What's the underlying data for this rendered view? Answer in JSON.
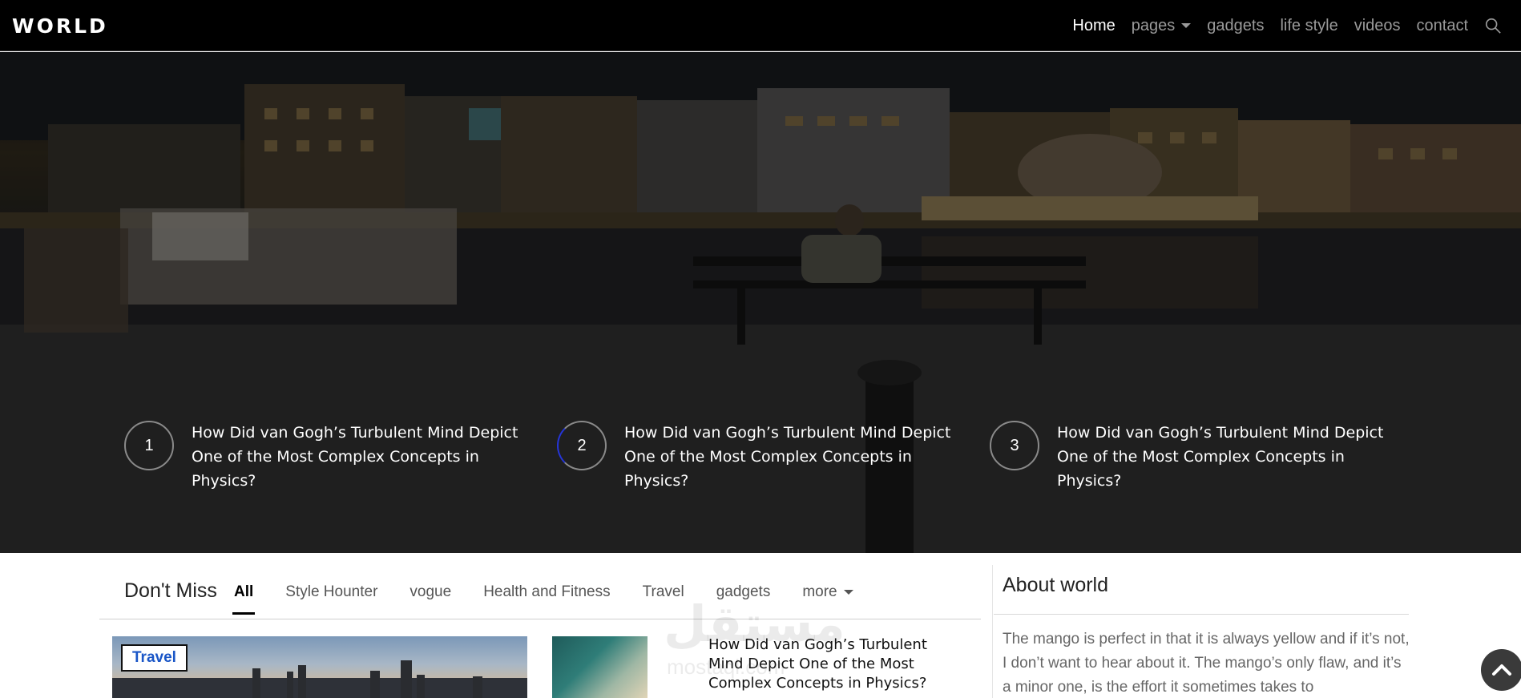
{
  "navbar": {
    "brand": "WORLD",
    "links": [
      {
        "label": "Home"
      },
      {
        "label": "pages"
      },
      {
        "label": "gadgets"
      },
      {
        "label": "life style"
      },
      {
        "label": "videos"
      },
      {
        "label": "contact"
      }
    ]
  },
  "hero": {
    "headlines": [
      {
        "number": "1",
        "title": "How Did van Gogh’s Turbulent Mind Depict One of the Most Complex Concepts in Physics?"
      },
      {
        "number": "2",
        "title": "How Did van Gogh’s Turbulent Mind Depict One of the Most Complex Concepts in Physics?"
      },
      {
        "number": "3",
        "title": "How Did van Gogh’s Turbulent Mind Depict One of the Most Complex Concepts in Physics?"
      }
    ]
  },
  "dont_miss": {
    "title": "Don't Miss",
    "tabs": [
      {
        "label": "All"
      },
      {
        "label": "Style Hounter"
      },
      {
        "label": "vogue"
      },
      {
        "label": "Health and Fitness"
      },
      {
        "label": "Travel"
      },
      {
        "label": "gadgets"
      },
      {
        "label": "more"
      }
    ],
    "featured": {
      "badge": "Travel"
    },
    "side_article": {
      "title": "How Did van Gogh’s Turbulent Mind Depict One of the Most Complex Concepts in Physics?"
    }
  },
  "about": {
    "title": "About world",
    "text": "The mango is perfect in that it is always yellow and if it’s not, I don’t want to hear about it. The mango’s only flaw, and it’s a minor one, is the effort it sometimes takes to"
  },
  "watermark": {
    "text": "مستقل",
    "sub": "mostaql.com"
  }
}
